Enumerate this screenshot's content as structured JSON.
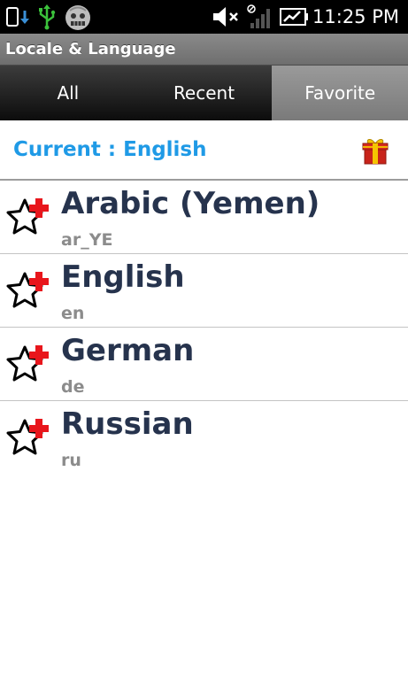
{
  "status_bar": {
    "time": "11:25 PM",
    "icons": [
      "phone-download-icon",
      "usb-icon",
      "debug-bug-icon",
      "volume-muted-icon",
      "signal-icon",
      "battery-icon"
    ]
  },
  "title_bar": {
    "title": "Locale & Language"
  },
  "tabs": [
    {
      "label": "All",
      "active": false
    },
    {
      "label": "Recent",
      "active": false
    },
    {
      "label": "Favorite",
      "active": true
    }
  ],
  "current": {
    "text": "Current : English",
    "icon": "gift-icon"
  },
  "languages": [
    {
      "name": "Arabic (Yemen)",
      "code": "ar_YE"
    },
    {
      "name": "English",
      "code": "en"
    },
    {
      "name": "German",
      "code": "de"
    },
    {
      "name": "Russian",
      "code": "ru"
    }
  ],
  "colors": {
    "accent": "#1f9ae6",
    "language_name": "#26334d",
    "language_code": "#8c8c8c",
    "star_plus": "#e8161c"
  }
}
